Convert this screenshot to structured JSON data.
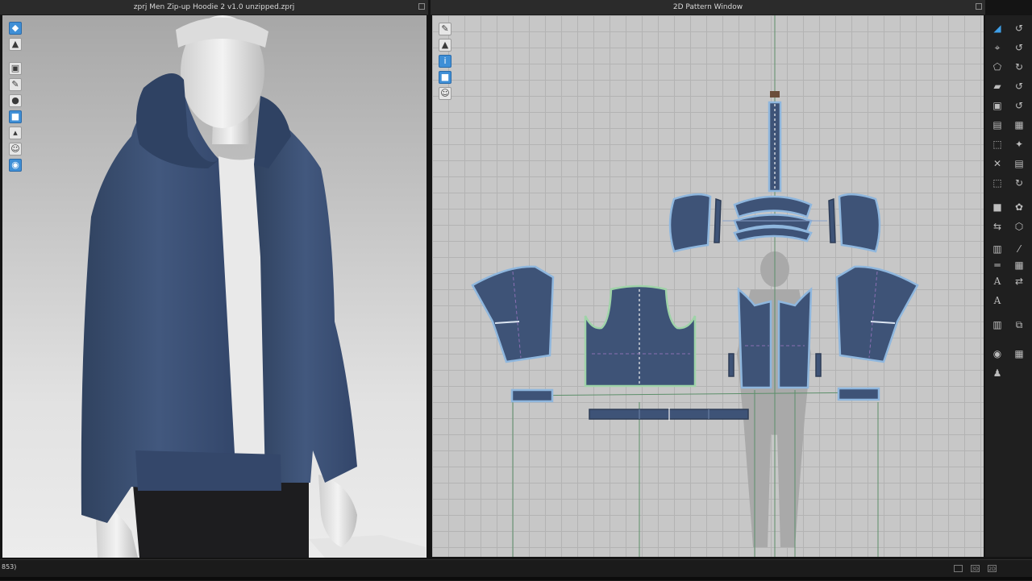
{
  "window3d": {
    "title": "zprj Men Zip-up Hoodie 2 v1.0 unzipped.zprj"
  },
  "window2d": {
    "title": "2D Pattern Window"
  },
  "status": {
    "text": "853)"
  },
  "colors": {
    "fabric": "#3e5377",
    "selection_outline": "#8fb7de",
    "grid_background": "#c7c7c7",
    "accent_blue": "#3f8fd6"
  },
  "toolbar3d": {
    "icons": [
      "cube-view-icon",
      "garment-icon",
      "avatar-display-icon",
      "texture-icon",
      "pose-icon",
      "fabric-render-icon",
      "shoe-icon",
      "avatar-icon",
      "globe-icon"
    ]
  },
  "toolbar2d": {
    "icons": [
      "edit-tool-icon",
      "shirt-icon",
      "info-icon",
      "fabric-icon",
      "avatar-silhouette-icon"
    ]
  },
  "right_toolbar": {
    "text_tool_label_1": "A",
    "text_tool_label_2": "A"
  }
}
